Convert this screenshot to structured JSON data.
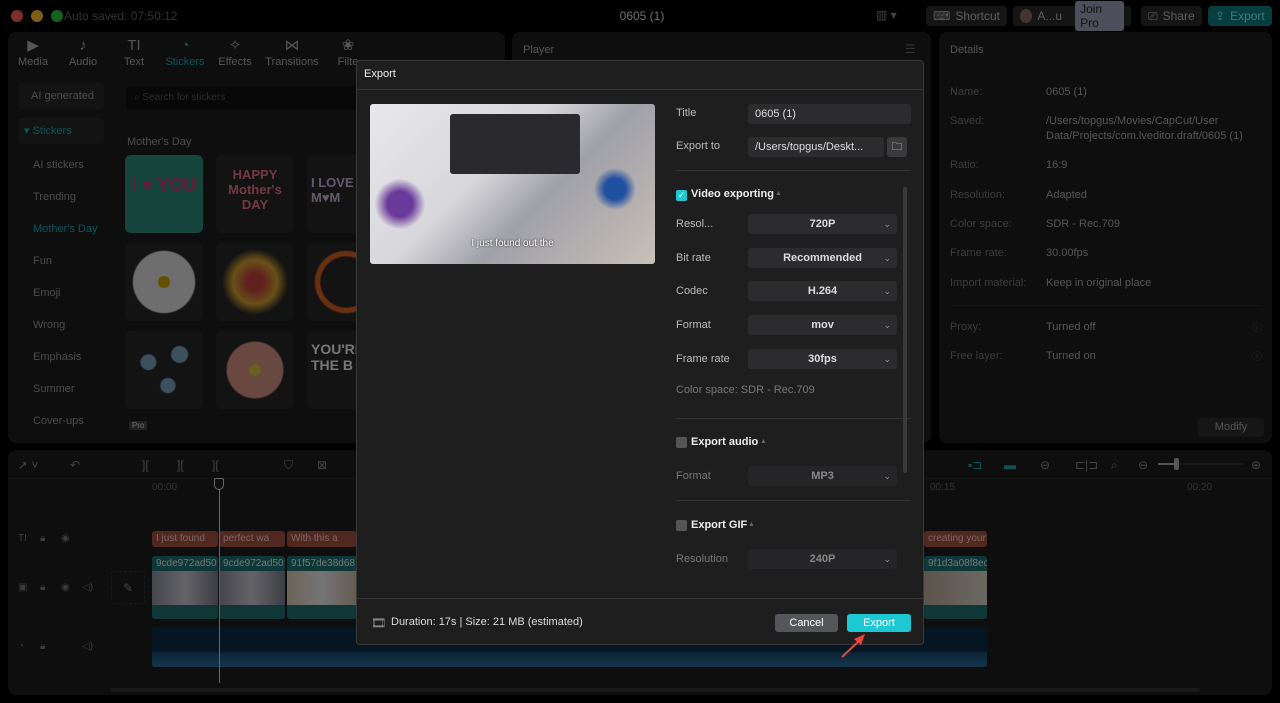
{
  "titlebar": {
    "auto_saved": "Auto saved: 07:50:12",
    "title": "0605 (1)",
    "shortcut": "Shortcut",
    "user": "A...u",
    "join_pro": "Join Pro",
    "share": "Share",
    "export": "Export"
  },
  "tabs": [
    {
      "label": "Media",
      "icon": "▶"
    },
    {
      "label": "Audio",
      "icon": "♪"
    },
    {
      "label": "Text",
      "icon": "TI"
    },
    {
      "label": "Stickers",
      "icon": "◔"
    },
    {
      "label": "Effects",
      "icon": "✧"
    },
    {
      "label": "Transitions",
      "icon": "⋈"
    },
    {
      "label": "Filte",
      "icon": "❀"
    }
  ],
  "sidebar": [
    "AI generated",
    "Stickers",
    "AI stickers",
    "Trending",
    "Mother's Day",
    "Fun",
    "Emoji",
    "Wrong",
    "Emphasis",
    "Summer",
    "Cover-ups"
  ],
  "search_placeholder": "Search for stickers",
  "section_title": "Mother's Day",
  "stickers": {
    "s1": "I ♥ YOU",
    "s2": "HAPPY Mother's DAY",
    "s3": "I LOVE M♥M",
    "s4": "YOU'RE THE B",
    "pro": "Pro"
  },
  "player": {
    "title": "Player"
  },
  "details": {
    "title": "Details",
    "rows": [
      {
        "label": "Name:",
        "value": "0605 (1)"
      },
      {
        "label": "Saved:",
        "value": "/Users/topgus/Movies/CapCut/User Data/Projects/com.lveditor.draft/0605 (1)"
      },
      {
        "label": "Ratio:",
        "value": "16:9"
      },
      {
        "label": "Resolution:",
        "value": "Adapted"
      },
      {
        "label": "Color space:",
        "value": "SDR - Rec.709"
      },
      {
        "label": "Frame rate:",
        "value": "30.00fps"
      },
      {
        "label": "Import material:",
        "value": "Keep in original place"
      },
      {
        "label": "Proxy:",
        "value": "Turned off"
      },
      {
        "label": "Free layer:",
        "value": "Turned on"
      }
    ],
    "modify": "Modify"
  },
  "timeline": {
    "t0": "00:00",
    "t15": "00:15",
    "t20": "00:20",
    "text_clips": [
      "I just found",
      "perfect wa",
      "With this a",
      "creating your"
    ],
    "video_clips": [
      "9cde972ad50",
      "9cde972ad50",
      "91f57de38d68",
      "9f1d3a08f8edb"
    ]
  },
  "dialog": {
    "title": "Export",
    "caption": "I just found out the",
    "title_label": "Title",
    "title_value": "0605 (1)",
    "export_to_label": "Export to",
    "export_to_value": "/Users/topgus/Deskt...",
    "video": {
      "label": "Video exporting",
      "checked": true,
      "fields": [
        {
          "label": "Resol...",
          "value": "720P"
        },
        {
          "label": "Bit rate",
          "value": "Recommended"
        },
        {
          "label": "Codec",
          "value": "H.264"
        },
        {
          "label": "Format",
          "value": "mov"
        },
        {
          "label": "Frame rate",
          "value": "30fps"
        }
      ],
      "color_space": "Color space: SDR - Rec.709"
    },
    "audio": {
      "label": "Export audio",
      "checked": false,
      "format_label": "Format",
      "format_value": "MP3"
    },
    "gif": {
      "label": "Export GIF",
      "checked": false,
      "res_label": "Resolution",
      "res_value": "240P"
    },
    "footer": "Duration: 17s | Size: 21 MB (estimated)",
    "cancel": "Cancel",
    "export": "Export"
  },
  "colors": {
    "accent": "#1ec8d2",
    "text_clip": "#a0503f",
    "video_clip": "#1f6e6e"
  }
}
